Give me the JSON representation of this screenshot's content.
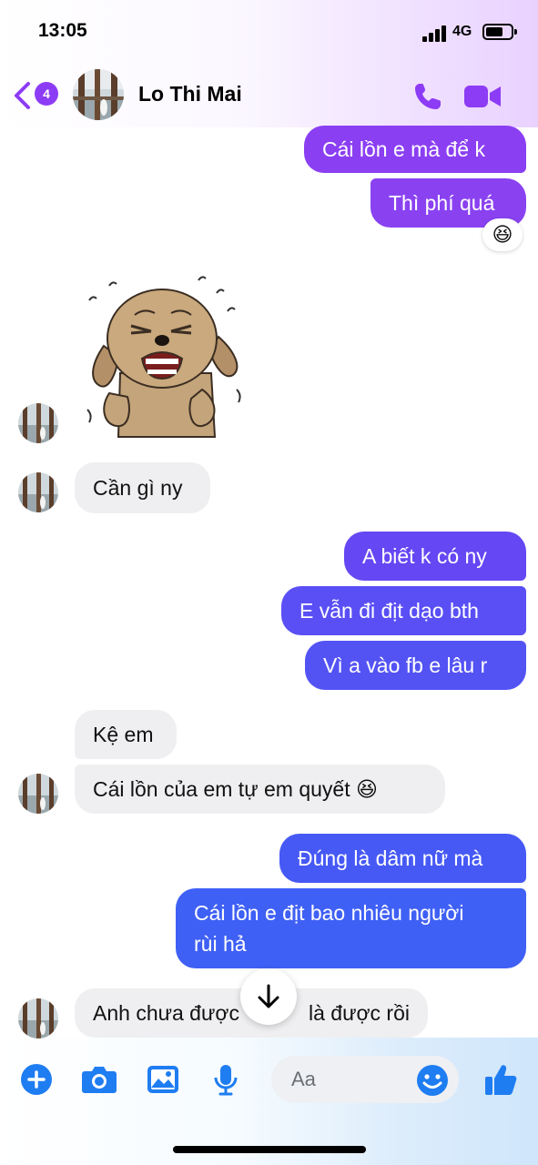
{
  "status_bar": {
    "time": "13:05",
    "network": "4G"
  },
  "header": {
    "back_badge": "4",
    "contact_name": "Lo Thi Mai",
    "icons": {
      "back": "chevron-left-icon",
      "call": "phone-icon",
      "video": "video-camera-icon"
    }
  },
  "colors": {
    "accent_purple": "#8d3cf5",
    "bubble_purple": "#8b3ff2",
    "bubble_violet": "#6a49f4",
    "bubble_blue": "#3f60f5",
    "incoming_bubble": "#efeff1",
    "composer_blue": "#1f7df2"
  },
  "messages": [
    {
      "direction": "outgoing",
      "text": "Cái lồn e mà để k"
    },
    {
      "direction": "outgoing",
      "text": "Thì phí quá",
      "reaction": "😆"
    },
    {
      "direction": "incoming",
      "type": "sticker",
      "sticker": "crying-dog-sticker"
    },
    {
      "direction": "incoming",
      "text": "Cần gì ny"
    },
    {
      "direction": "outgoing",
      "text": "A biết k có ny"
    },
    {
      "direction": "outgoing",
      "text": "E vẫn đi địt dạo bth"
    },
    {
      "direction": "outgoing",
      "text": "Vì a vào fb e lâu r"
    },
    {
      "direction": "incoming",
      "text": "Kệ em"
    },
    {
      "direction": "incoming",
      "text": "Cái lồn của em tự em quyết 😆"
    },
    {
      "direction": "outgoing",
      "text": "Đúng là dâm nữ mà"
    },
    {
      "direction": "outgoing",
      "text_line1": "Cái lồn e địt bao nhiêu người",
      "text_line2": "rùi hả"
    },
    {
      "direction": "incoming",
      "text_left": "Anh chưa được",
      "text_right": "là được rồi"
    }
  ],
  "composer": {
    "placeholder": "Aa",
    "icons": [
      "plus-icon",
      "camera-icon",
      "image-icon",
      "microphone-icon",
      "emoji-icon",
      "thumbs-up-icon"
    ]
  }
}
